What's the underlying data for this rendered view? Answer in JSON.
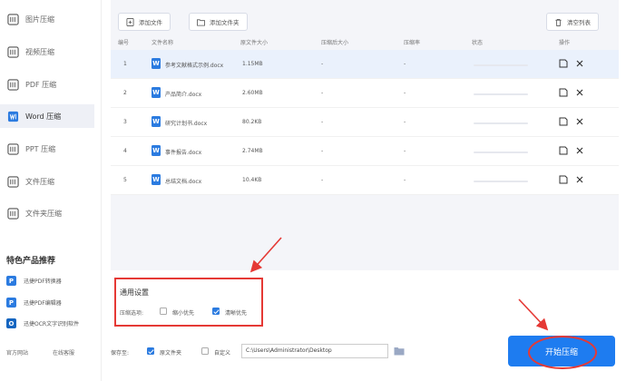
{
  "sidebar": {
    "items": [
      {
        "label": "图片压缩",
        "icon": "image-icon"
      },
      {
        "label": "视频压缩",
        "icon": "video-icon"
      },
      {
        "label": "PDF 压缩",
        "icon": "pdf-icon"
      },
      {
        "label": "Word 压缩",
        "icon": "word-icon",
        "active": true
      },
      {
        "label": "PPT 压缩",
        "icon": "ppt-icon"
      },
      {
        "label": "文件压缩",
        "icon": "file-icon"
      },
      {
        "label": "文件夹压缩",
        "icon": "folder-icon"
      }
    ],
    "featured_title": "特色产品推荐",
    "products": [
      {
        "label": "迅捷PDF转换器",
        "icon": "pdf-converter-icon",
        "color": "#2b7be0",
        "glyph": "P"
      },
      {
        "label": "迅捷PDF编辑器",
        "icon": "pdf-editor-icon",
        "color": "#2b7be0",
        "glyph": "P"
      },
      {
        "label": "迅捷OCR文字识别软件",
        "icon": "ocr-icon",
        "color": "#1565c0",
        "glyph": "O"
      }
    ],
    "footer": {
      "home": "官方网站",
      "feedback": "在线客服"
    }
  },
  "toolbar": {
    "add_file": "添加文件",
    "add_folder": "添加文件夹",
    "clear_list": "清空列表"
  },
  "table": {
    "headers": [
      "编号",
      "文件名称",
      "原文件大小",
      "压缩后大小",
      "压缩率",
      "状态",
      "操作"
    ],
    "rows": [
      {
        "no": "1",
        "name": "参考文献格式示例.docx",
        "size": "1.15MB",
        "compressed": "-",
        "ratio": "-",
        "progress": 0
      },
      {
        "no": "2",
        "name": "产品简介.docx",
        "size": "2.60MB",
        "compressed": "-",
        "ratio": "-",
        "progress": 0
      },
      {
        "no": "3",
        "name": "研究计划书.docx",
        "size": "80.2KB",
        "compressed": "-",
        "ratio": "-",
        "progress": 0
      },
      {
        "no": "4",
        "name": "事件报告.docx",
        "size": "2.74MB",
        "compressed": "-",
        "ratio": "-",
        "progress": 0
      },
      {
        "no": "5",
        "name": "总结文档.docx",
        "size": "10.4KB",
        "compressed": "-",
        "ratio": "-",
        "progress": 0
      }
    ]
  },
  "settings": {
    "title": "通用设置",
    "mode_label": "压缩选项:",
    "option_small": "缩小优先",
    "option_clear": "清晰优先",
    "small_checked": false,
    "clear_checked": true
  },
  "bottom": {
    "save_label": "保存至:",
    "original_folder": "原文件夹",
    "custom": "自定义",
    "path": "C:\\Users\\Administrator\\Desktop"
  },
  "start_button": "开始压缩",
  "colors": {
    "accent": "#1e7cf0",
    "annotation": "#e53935",
    "active_bg": "#eef0f6"
  }
}
